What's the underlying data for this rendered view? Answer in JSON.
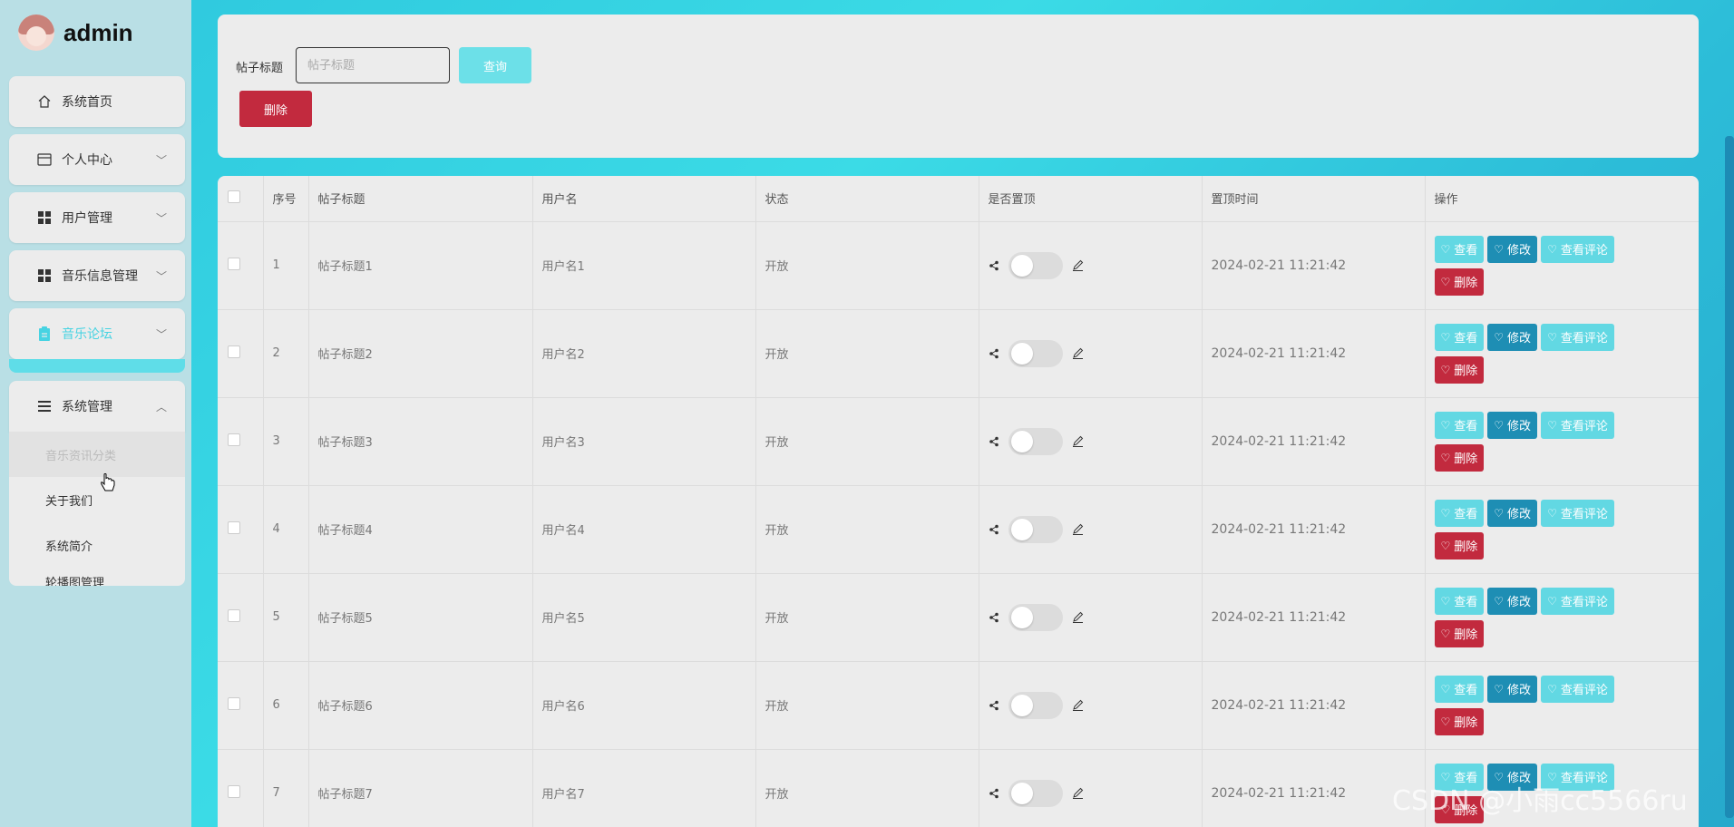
{
  "brand": {
    "name": "admin"
  },
  "sidebar": {
    "items": [
      {
        "label": "系统首页",
        "icon": "home-icon"
      },
      {
        "label": "个人中心",
        "icon": "card-icon"
      },
      {
        "label": "用户管理",
        "icon": "grid-icon"
      },
      {
        "label": "音乐信息管理",
        "icon": "grid-icon"
      },
      {
        "label": "音乐论坛",
        "icon": "clipboard-icon"
      },
      {
        "label": "系统管理",
        "icon": "list-icon"
      }
    ],
    "submenu": [
      "音乐资讯分类",
      "关于我们",
      "系统简介",
      "轮播图管理"
    ]
  },
  "search": {
    "label": "帖子标题",
    "placeholder": "帖子标题",
    "query_label": "查询",
    "delete_label": "删除"
  },
  "table": {
    "headers": [
      "序号",
      "帖子标题",
      "用户名",
      "状态",
      "是否置顶",
      "置顶时间",
      "操作"
    ],
    "rows": [
      {
        "no": "1",
        "title": "帖子标题1",
        "user": "用户名1",
        "status": "开放",
        "time": "2024-02-21 11:21:42"
      },
      {
        "no": "2",
        "title": "帖子标题2",
        "user": "用户名2",
        "status": "开放",
        "time": "2024-02-21 11:21:42"
      },
      {
        "no": "3",
        "title": "帖子标题3",
        "user": "用户名3",
        "status": "开放",
        "time": "2024-02-21 11:21:42"
      },
      {
        "no": "4",
        "title": "帖子标题4",
        "user": "用户名4",
        "status": "开放",
        "time": "2024-02-21 11:21:42"
      },
      {
        "no": "5",
        "title": "帖子标题5",
        "user": "用户名5",
        "status": "开放",
        "time": "2024-02-21 11:21:42"
      },
      {
        "no": "6",
        "title": "帖子标题6",
        "user": "用户名6",
        "status": "开放",
        "time": "2024-02-21 11:21:42"
      },
      {
        "no": "7",
        "title": "帖子标题7",
        "user": "用户名7",
        "status": "开放",
        "time": "2024-02-21 11:21:42"
      }
    ],
    "actions": {
      "view": "查看",
      "edit": "修改",
      "comments": "查看评论",
      "delete": "删除"
    }
  },
  "watermark": "CSDN @小雨cc5566ru",
  "colors": {
    "accent": "#47d3e2",
    "danger": "#c22a3e",
    "edit": "#1e8eb4"
  }
}
